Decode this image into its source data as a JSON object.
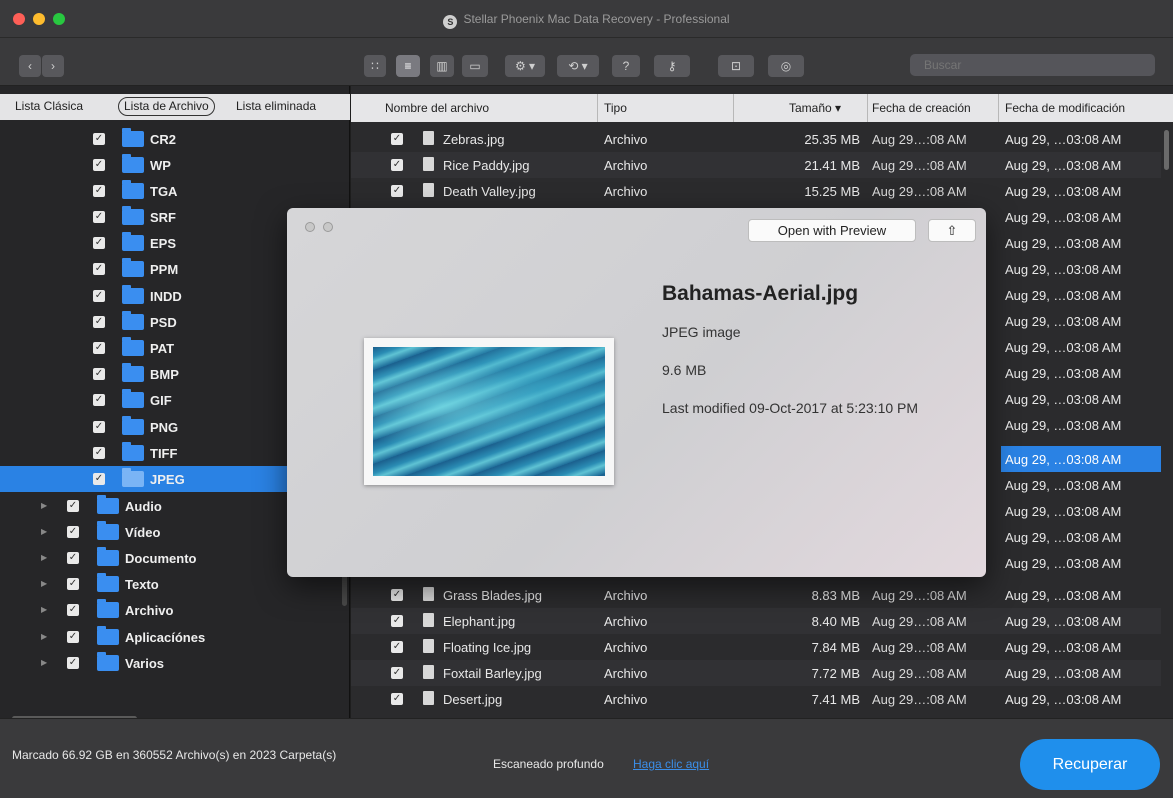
{
  "window": {
    "title": "Stellar Phoenix Mac Data Recovery - Professional",
    "logo_icon": "stellar-logo-icon"
  },
  "toolbar": {
    "back_icon": "chevron-left-icon",
    "forward_icon": "chevron-right-icon",
    "view_icons": [
      "icon-view-icon",
      "list-view-icon",
      "column-view-icon",
      "coverflow-view-icon"
    ],
    "action_icons": [
      "gear-icon",
      "history-icon",
      "help-icon",
      "activate-icon",
      "cart-icon",
      "account-icon"
    ],
    "help_glyph": "?",
    "search_placeholder": "Buscar"
  },
  "sidebar": {
    "tabs": [
      "Lista Clásica",
      "Lista de Archivo",
      "Lista eliminada"
    ],
    "selected_tab": "Lista de Archivo",
    "items": [
      {
        "label": "CR2",
        "checked": true,
        "selected": false
      },
      {
        "label": "WP",
        "checked": true,
        "selected": false
      },
      {
        "label": "TGA",
        "checked": true,
        "selected": false
      },
      {
        "label": "SRF",
        "checked": true,
        "selected": false
      },
      {
        "label": "EPS",
        "checked": true,
        "selected": false
      },
      {
        "label": "PPM",
        "checked": true,
        "selected": false
      },
      {
        "label": "INDD",
        "checked": true,
        "selected": false
      },
      {
        "label": "PSD",
        "checked": true,
        "selected": false
      },
      {
        "label": "PAT",
        "checked": true,
        "selected": false
      },
      {
        "label": "BMP",
        "checked": true,
        "selected": false
      },
      {
        "label": "GIF",
        "checked": true,
        "selected": false
      },
      {
        "label": "PNG",
        "checked": true,
        "selected": false
      },
      {
        "label": "TIFF",
        "checked": true,
        "selected": false
      },
      {
        "label": "JPEG",
        "checked": true,
        "selected": true
      }
    ],
    "categories": [
      {
        "label": "Audio",
        "checked": true
      },
      {
        "label": "Vídeo",
        "checked": true
      },
      {
        "label": "Documento",
        "checked": true
      },
      {
        "label": "Texto",
        "checked": true
      },
      {
        "label": "Archivo",
        "checked": true
      },
      {
        "label": "Aplicacíónes",
        "checked": true
      },
      {
        "label": "Varios",
        "checked": true
      }
    ]
  },
  "filelist": {
    "columns": [
      "Nombre del archivo",
      "Tipo",
      "Tamaño ▾",
      "Fecha de creación",
      "Fecha de modificación"
    ],
    "rows_top": [
      {
        "name": "Zebras.jpg",
        "type": "Archivo",
        "size": "25.35 MB",
        "created": "Aug 29…:08 AM",
        "modified": "Aug 29, …03:08 AM"
      },
      {
        "name": "Rice Paddy.jpg",
        "type": "Archivo",
        "size": "21.41 MB",
        "created": "Aug 29…:08 AM",
        "modified": "Aug 29, …03:08 AM"
      },
      {
        "name": "Death Valley.jpg",
        "type": "Archivo",
        "size": "15.25 MB",
        "created": "Aug 29…:08 AM",
        "modified": "Aug 29, …03:08 AM"
      }
    ],
    "rows_bottom": [
      {
        "name": "Grass Blades.jpg",
        "type": "Archivo",
        "size": "8.83 MB",
        "created": "Aug 29…:08 AM",
        "modified": "Aug 29, …03:08 AM"
      },
      {
        "name": "Elephant.jpg",
        "type": "Archivo",
        "size": "8.40 MB",
        "created": "Aug 29…:08 AM",
        "modified": "Aug 29, …03:08 AM"
      },
      {
        "name": "Floating Ice.jpg",
        "type": "Archivo",
        "size": "7.84 MB",
        "created": "Aug 29…:08 AM",
        "modified": "Aug 29, …03:08 AM"
      },
      {
        "name": "Foxtail Barley.jpg",
        "type": "Archivo",
        "size": "7.72 MB",
        "created": "Aug 29…:08 AM",
        "modified": "Aug 29, …03:08 AM"
      },
      {
        "name": "Desert.jpg",
        "type": "Archivo",
        "size": "7.41 MB",
        "created": "Aug 29…:08 AM",
        "modified": "Aug 29, …03:08 AM"
      }
    ],
    "mod_column_hidden": [
      "Aug 29, …03:08 AM",
      "Aug 29, …03:08 AM",
      "Aug 29, …03:08 AM",
      "Aug 29, …03:08 AM",
      "Aug 29, …03:08 AM",
      "Aug 29, …03:08 AM",
      "Aug 29, …03:08 AM",
      "Aug 29, …03:08 AM",
      "Aug 29, …03:08 AM",
      "Aug 29, …03:08 AM",
      "Aug 29, …03:08 AM",
      "Aug 29, …03:08 AM",
      "Aug 29, …03:08 AM",
      "Aug 29, …03:08 AM"
    ],
    "selected_mod_index": 6
  },
  "quicklook": {
    "open_button": "Open with Preview",
    "share_icon": "share-icon",
    "share_glyph": "⇧",
    "file_name": "Bahamas-Aerial.jpg",
    "file_type": "JPEG image",
    "file_size": "9.6 MB",
    "last_modified": "Last modified 09-Oct-2017 at 5:23:10 PM"
  },
  "status": {
    "summary": "Marcado 66.92 GB en 360552 Archivo(s) en 2023 Carpeta(s)",
    "deep_scan_label": "Escaneado profundo",
    "deep_scan_link": "Haga clic aquí",
    "recover_button": "Recuperar"
  },
  "colors": {
    "accent": "#2a82e4",
    "folder": "#3a8ef0",
    "recover": "#1f8fec"
  }
}
